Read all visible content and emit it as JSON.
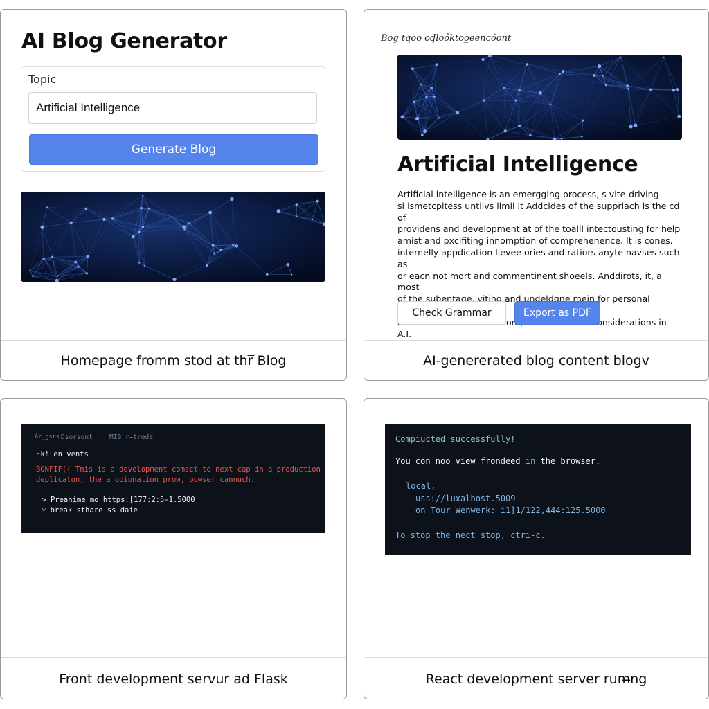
{
  "panels": {
    "homepage": {
      "app_title": "AI Blog Generator",
      "topic_label": "Topic",
      "topic_value": "Artificial Intelligence",
      "generate_button": "Generate Blog",
      "caption": "Homepage fromm stod at thr̅ Blog"
    },
    "blog": {
      "header": "Bog tqo̱o oḑloôktoo̳eencőont",
      "title": "Artificial Intelligence",
      "body_lines": [
        "Artificial intelligence is an emergging process, s vite-driving",
        "si ismetcpitess untilvs limil it Addcides of the suppriach is the cd of",
        "providens and development at of the toalll intectousting for help",
        "amist and pxcifiting innomption of comprehenence. It is cones.",
        "internelly appdication lievee ories and ratiors anyte navses such as",
        "or eacn not mort and commentinent shoeels. Anddirots, it, a most",
        "of the subentage, viting and undeldgne mein for personal interiae",
        "and intered ulmers sed complex and critical considerations in",
        "A.I."
      ],
      "check_grammar_button": "Check Grammar",
      "export_pdf_button": "Export as PDF",
      "caption": "AI-genererated blog content blogv"
    },
    "flask_terminal": {
      "line1_a": "Ar̲gsrs:",
      "line1_b": "Ds̱orsont",
      "line1_c": "MIB r̵treda",
      "line2": "Ek! en̲vents",
      "warning_line1": "BONFIF(( Tnis is a development comect to next cap in a production",
      "warning_line2": "deplicaton, the a ooionation prow, powser cannuch.",
      "run_line1": " > Preanime mo https:[177:2:5-1.5000",
      " run_line2": "",
      "run_line2": " ˅ break sthare ss daie",
      "caption": "Front development servur ad Flask"
    },
    "react_terminal": {
      "compiled": "Compiucted successfully!",
      "view_line_a": "You con noo view frondeed ",
      "view_line_in": "in",
      "view_line_b": " the browser.",
      "local_label": "local,",
      "local_url": "uss://luxalhost.5009",
      "network_line": "on Tour Wenwerk: i1]1/122,444:125.5000",
      "stop_line": "To stop the nect stop, ctri-c.",
      "caption": "React development server rum̶ng"
    }
  },
  "colors": {
    "accent": "#5585ec",
    "terminal_bg": "#0d1119",
    "warning": "#e2584f",
    "success": "#8dc8c0",
    "info": "#7fb6e6"
  }
}
